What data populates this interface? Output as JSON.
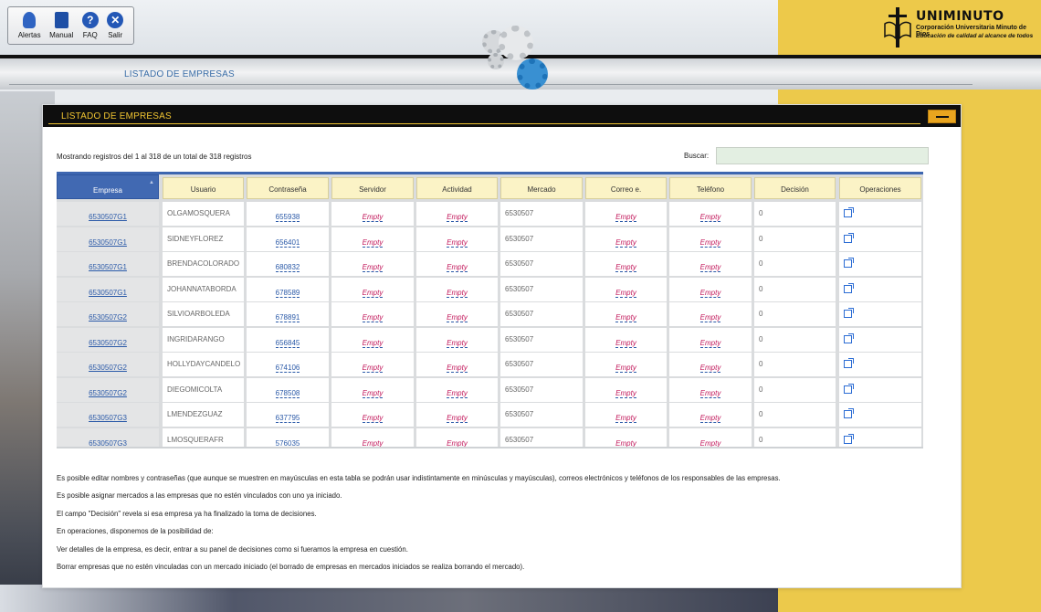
{
  "toolbar": {
    "items": [
      {
        "label": "Alertas",
        "icon": "bell-icon"
      },
      {
        "label": "Manual",
        "icon": "book-icon"
      },
      {
        "label": "FAQ",
        "icon": "help-icon",
        "glyph": "?"
      },
      {
        "label": "Salir",
        "icon": "close-icon",
        "glyph": "✕"
      }
    ]
  },
  "logo": {
    "brand": "UNIMINUTO",
    "line1": "Corporación Universitaria Minuto de Dios",
    "line2": "Educación de calidad al alcance de todos"
  },
  "nav": {
    "title": "LISTADO DE EMPRESAS"
  },
  "panel": {
    "title": "LISTADO DE EMPRESAS",
    "info": "Mostrando registros del 1 al 318 de un total de 318 registros",
    "search_label": "Buscar:",
    "search_value": ""
  },
  "table": {
    "columns": [
      "Empresa",
      "Usuario",
      "Contraseña",
      "Servidor",
      "Actividad",
      "Mercado",
      "Correo e.",
      "Teléfono",
      "Decisión",
      "Operaciones"
    ],
    "sort_arrow": "▲",
    "rows": [
      {
        "empresa": "6530507G1",
        "usuario": "OLGAMOSQUERA",
        "contrasena": "655938",
        "servidor": "Empty",
        "actividad": "Empty",
        "mercado": "6530507",
        "correo": "Empty",
        "telefono": "Empty",
        "decision": "0"
      },
      {
        "empresa": "6530507G1",
        "usuario": "SIDNEYFLOREZ",
        "contrasena": "656401",
        "servidor": "Empty",
        "actividad": "Empty",
        "mercado": "6530507",
        "correo": "Empty",
        "telefono": "Empty",
        "decision": "0"
      },
      {
        "empresa": "6530507G1",
        "usuario": "BRENDACOLORADO",
        "contrasena": "680832",
        "servidor": "Empty",
        "actividad": "Empty",
        "mercado": "6530507",
        "correo": "Empty",
        "telefono": "Empty",
        "decision": "0"
      },
      {
        "empresa": "6530507G1",
        "usuario": "JOHANNATABORDA",
        "contrasena": "678589",
        "servidor": "Empty",
        "actividad": "Empty",
        "mercado": "6530507",
        "correo": "Empty",
        "telefono": "Empty",
        "decision": "0"
      },
      {
        "empresa": "6530507G2",
        "usuario": "SILVIOARBOLEDA",
        "contrasena": "678891",
        "servidor": "Empty",
        "actividad": "Empty",
        "mercado": "6530507",
        "correo": "Empty",
        "telefono": "Empty",
        "decision": "0"
      },
      {
        "empresa": "6530507G2",
        "usuario": "INGRIDARANGO",
        "contrasena": "656845",
        "servidor": "Empty",
        "actividad": "Empty",
        "mercado": "6530507",
        "correo": "Empty",
        "telefono": "Empty",
        "decision": "0"
      },
      {
        "empresa": "6530507G2",
        "usuario": "HOLLYDAYCANDELO",
        "contrasena": "674106",
        "servidor": "Empty",
        "actividad": "Empty",
        "mercado": "6530507",
        "correo": "Empty",
        "telefono": "Empty",
        "decision": "0"
      },
      {
        "empresa": "6530507G2",
        "usuario": "DIEGOMICOLTA",
        "contrasena": "678508",
        "servidor": "Empty",
        "actividad": "Empty",
        "mercado": "6530507",
        "correo": "Empty",
        "telefono": "Empty",
        "decision": "0"
      },
      {
        "empresa": "6530507G3",
        "usuario": "LMENDEZGUAZ",
        "contrasena": "637795",
        "servidor": "Empty",
        "actividad": "Empty",
        "mercado": "6530507",
        "correo": "Empty",
        "telefono": "Empty",
        "decision": "0"
      },
      {
        "empresa": "6530507G3",
        "usuario": "LMOSQUERAFR",
        "contrasena": "576035",
        "servidor": "Empty",
        "actividad": "Empty",
        "mercado": "6530507",
        "correo": "Empty",
        "telefono": "Empty",
        "decision": "0"
      }
    ]
  },
  "notes": [
    "Es posible editar nombres y contraseñas (que aunque se muestren en mayúsculas en esta tabla se podrán usar indistintamente en minúsculas y mayúsculas), correos electrónicos y teléfonos de los responsables de las empresas.",
    "Es posible asignar mercados a las empresas que no estén vinculados con uno ya iniciado.",
    "El campo \"Decisión\" revela si esa empresa ya ha finalizado la toma de decisiones.",
    "En operaciones, disponemos de la posibilidad de:",
    "Ver detalles de la empresa, es decir, entrar a su panel de decisiones como si fueramos la empresa en cuestión.",
    "Borrar empresas que no estén vinculadas con un mercado iniciado (el borrado de empresas en mercados iniciados se realiza borrando el mercado)."
  ],
  "colors": {
    "accent": "#f0c431",
    "header_blue": "#4169b2",
    "link": "#2b5aa8",
    "empty": "#c2185b"
  }
}
